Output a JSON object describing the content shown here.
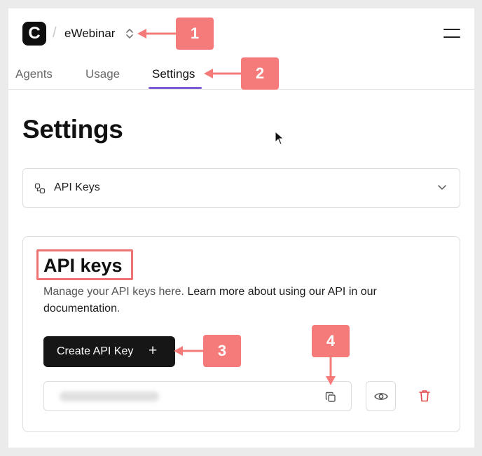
{
  "header": {
    "logo_letter": "C",
    "separator": "/",
    "org_name": "eWebinar"
  },
  "tabs": [
    {
      "label": "Agents"
    },
    {
      "label": "Usage"
    },
    {
      "label": "Settings",
      "active": true
    }
  ],
  "page": {
    "title": "Settings"
  },
  "accordion": {
    "label": "API Keys"
  },
  "api_keys": {
    "title": "API keys",
    "description_plain": "Manage your API keys here. ",
    "description_link": "Learn more about using our API in our documentation",
    "description_end": ".",
    "create_label": "Create API Key",
    "create_plus": "+"
  },
  "callouts": [
    "1",
    "2",
    "3",
    "4"
  ],
  "icons": {
    "switcher": "chevron-up-down-icon",
    "menu": "menu-icon",
    "accordion": "api-keys-icon",
    "chevron": "chevron-down-icon",
    "copy": "copy-icon",
    "view": "eye-icon",
    "delete": "trash-icon"
  },
  "colors": {
    "accent": "#7c5cd6",
    "callout": "#f57b7b",
    "danger": "#e04848",
    "primary_button": "#161616"
  }
}
